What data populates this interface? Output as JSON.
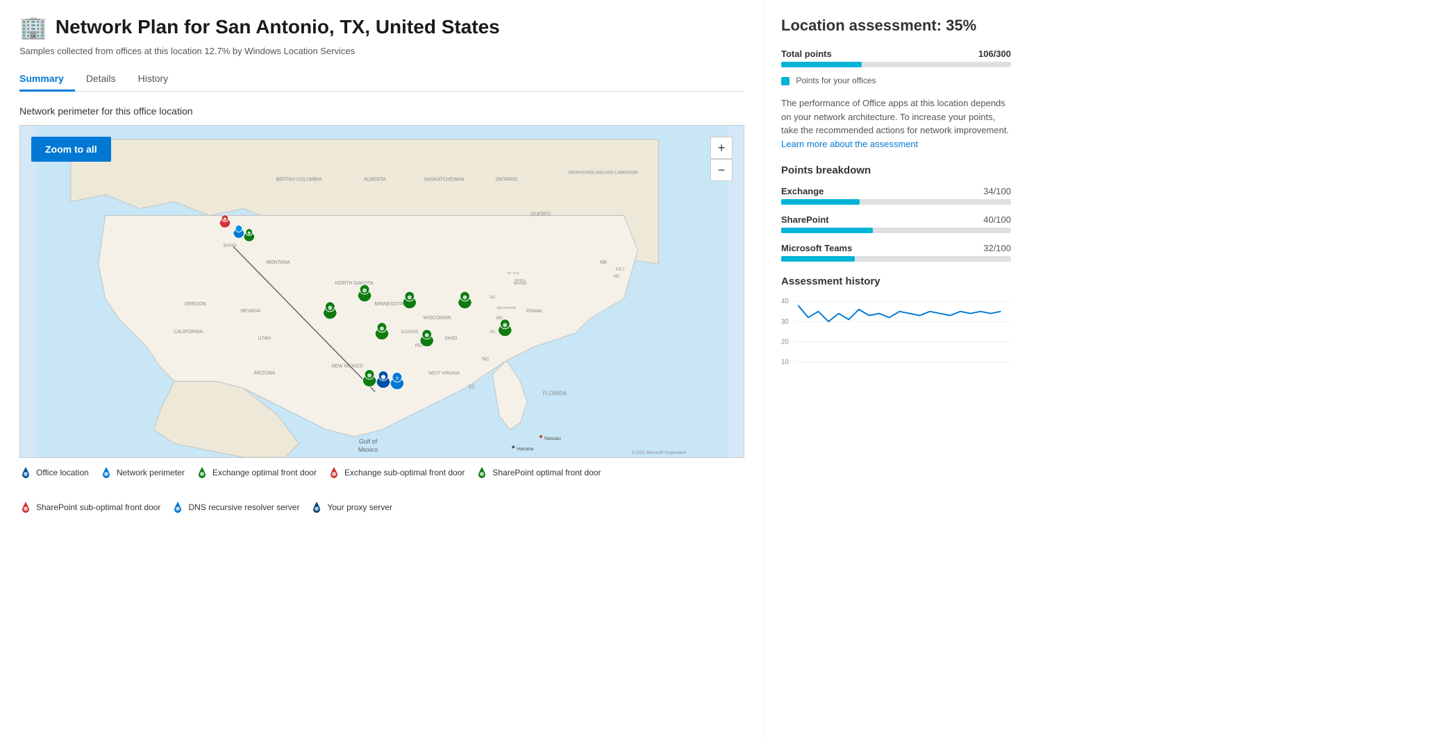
{
  "header": {
    "icon": "🏢",
    "title": "Network Plan for San Antonio, TX, United States",
    "subtitle": "Samples collected from offices at this location 12.7% by Windows Location Services"
  },
  "tabs": [
    {
      "id": "summary",
      "label": "Summary",
      "active": true
    },
    {
      "id": "details",
      "label": "Details",
      "active": false
    },
    {
      "id": "history",
      "label": "History",
      "active": false
    }
  ],
  "map": {
    "section_title": "Network perimeter for this office location",
    "zoom_all_label": "Zoom to all",
    "zoom_in_label": "+",
    "zoom_out_label": "−",
    "copyright": "© 2021 Microsoft Corporation",
    "legend": [
      {
        "id": "office-location",
        "label": "Office location",
        "color": "#0050a0",
        "shape": "pin"
      },
      {
        "id": "network-perimeter",
        "label": "Network perimeter",
        "color": "#0078d4",
        "shape": "pin"
      },
      {
        "id": "exchange-optimal",
        "label": "Exchange optimal front door",
        "color": "#107c10",
        "shape": "pin"
      },
      {
        "id": "exchange-suboptimal",
        "label": "Exchange sub-optimal front door",
        "color": "#d13438",
        "shape": "pin"
      },
      {
        "id": "sharepoint-optimal",
        "label": "SharePoint optimal front door",
        "color": "#107c10",
        "shape": "pin"
      },
      {
        "id": "sharepoint-suboptimal",
        "label": "SharePoint sub-optimal front door",
        "color": "#d13438",
        "shape": "pin"
      },
      {
        "id": "dns-resolver",
        "label": "DNS recursive resolver server",
        "color": "#0078d4",
        "shape": "pin"
      },
      {
        "id": "proxy-server",
        "label": "Your proxy server",
        "color": "#004578",
        "shape": "pin"
      }
    ]
  },
  "assessment": {
    "title": "Location assessment:",
    "score": "35%",
    "total_points_label": "Total points",
    "total_points_value": "106/300",
    "total_points_percent": 35,
    "points_legend_label": "Points for your offices",
    "description": "The performance of Office apps at this location depends on your network architecture. To increase your points, take the recommended actions for network improvement.",
    "learn_more_text": "Learn more about the assessment",
    "breakdown_title": "Points breakdown",
    "breakdown": [
      {
        "name": "Exchange",
        "score": "34/100",
        "percent": 34
      },
      {
        "name": "SharePoint",
        "score": "40/100",
        "percent": 40
      },
      {
        "name": "Microsoft Teams",
        "score": "32/100",
        "percent": 32
      }
    ],
    "history_title": "Assessment history",
    "history_y_labels": [
      "40",
      "30",
      "20",
      "10"
    ],
    "history_data": [
      38,
      32,
      35,
      30,
      34,
      31,
      36,
      33,
      34,
      32,
      35,
      34,
      33,
      35,
      34,
      33,
      35,
      34
    ]
  }
}
